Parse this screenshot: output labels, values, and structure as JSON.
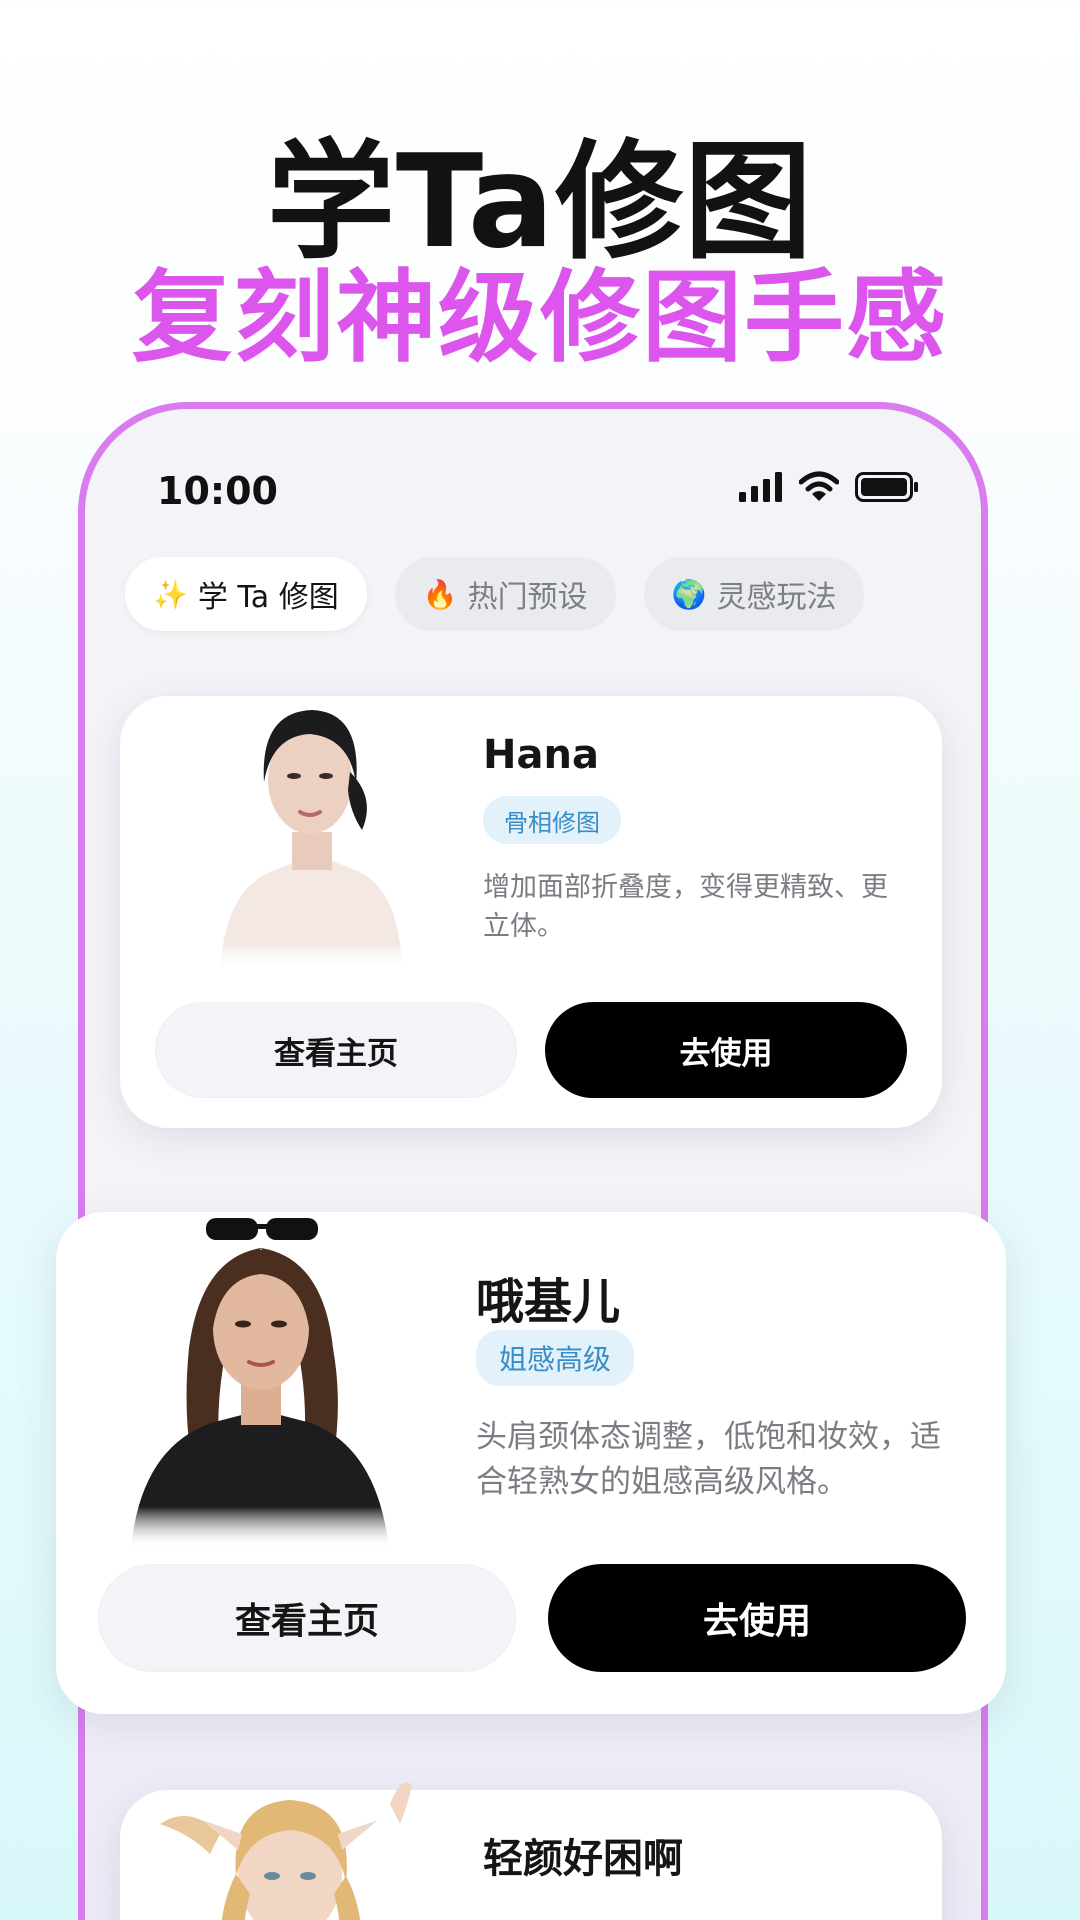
{
  "hero": {
    "title": "学Ta修图",
    "subtitle": "复刻神级修图手感"
  },
  "colors": {
    "accent_pink": "#dc55ec",
    "phone_border": "#d87cf0",
    "tag_bg": "#e3f1fb",
    "tag_text": "#3a8ec8",
    "primary_button": "#000000"
  },
  "status_bar": {
    "time": "10:00",
    "icons": [
      "signal-icon",
      "wifi-icon",
      "battery-icon"
    ]
  },
  "tabs": [
    {
      "icon": "✨",
      "icon_name": "sparkles-icon",
      "label": "学 Ta 修图",
      "active": true
    },
    {
      "icon": "🔥",
      "icon_name": "fire-icon",
      "label": "热门预设",
      "active": false
    },
    {
      "icon": "🌍",
      "icon_name": "globe-icon",
      "label": "灵感玩法",
      "active": false
    }
  ],
  "cards": [
    {
      "name": "Hana",
      "tag": "骨相修图",
      "description": "增加面部折叠度，变得更精致、更立体。",
      "secondary_button": "查看主页",
      "primary_button": "去使用"
    },
    {
      "name": "哦基儿",
      "tag": "姐感高级",
      "description": "头肩颈体态调整，低饱和妆效，适合轻熟女的姐感高级风格。",
      "secondary_button": "查看主页",
      "primary_button": "去使用"
    },
    {
      "name": "轻颜好困啊"
    }
  ]
}
